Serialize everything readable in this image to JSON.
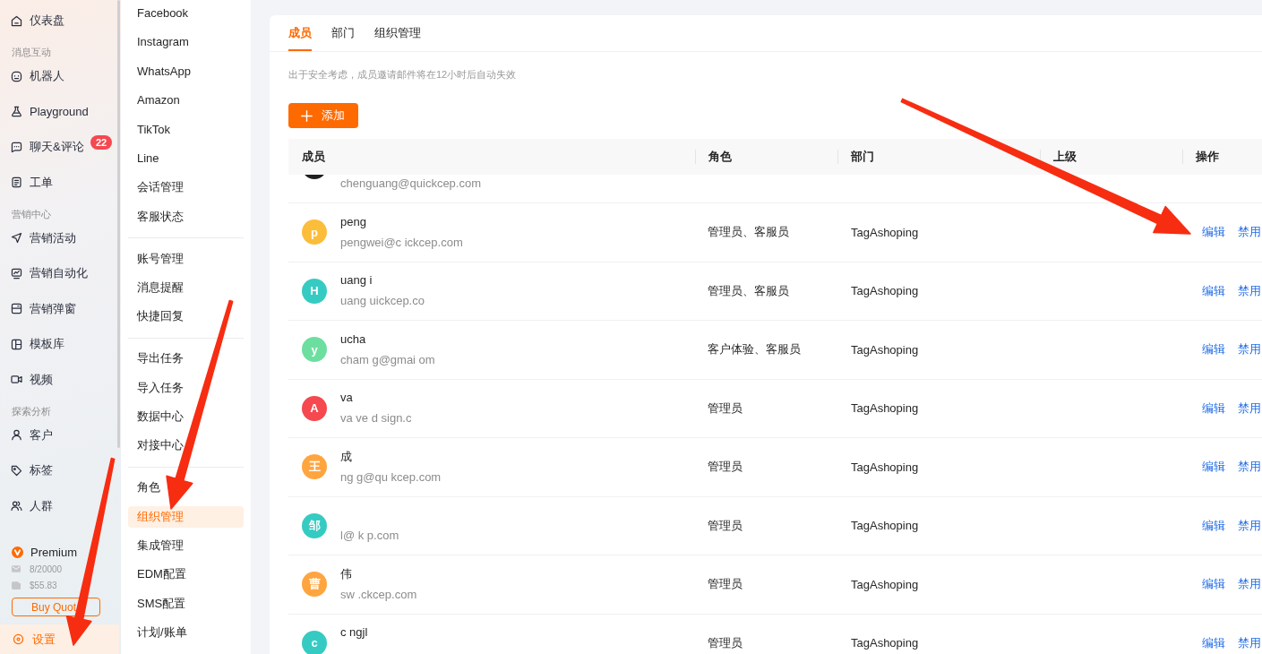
{
  "sidebar": {
    "items": [
      {
        "kind": "link",
        "label": "仪表盘",
        "selected": false
      },
      {
        "kind": "section",
        "label": "消息互动"
      },
      {
        "kind": "link",
        "label": "机器人",
        "selected": false
      },
      {
        "kind": "link",
        "label": "Playground",
        "selected": false
      },
      {
        "kind": "link",
        "label": "聊天&评论",
        "selected": false,
        "badge": "22"
      },
      {
        "kind": "link",
        "label": "工单",
        "selected": false
      },
      {
        "kind": "section",
        "label": "营销中心"
      },
      {
        "kind": "link",
        "label": "营销活动",
        "selected": false
      },
      {
        "kind": "link",
        "label": "营销自动化",
        "selected": false
      },
      {
        "kind": "link",
        "label": "营销弹窗",
        "selected": false
      },
      {
        "kind": "link",
        "label": "模板库",
        "selected": false
      },
      {
        "kind": "link",
        "label": "视频",
        "selected": false
      },
      {
        "kind": "section",
        "label": "探索分析"
      },
      {
        "kind": "link",
        "label": "客户",
        "selected": false
      },
      {
        "kind": "link",
        "label": "标签",
        "selected": false
      },
      {
        "kind": "link",
        "label": "人群",
        "selected": false
      }
    ],
    "plan": {
      "name": "Premium",
      "email_quota": "8/20000",
      "balance": "$55.83",
      "button": "Buy Quot"
    },
    "settings": {
      "label": "设置",
      "selected": true
    }
  },
  "subnav": {
    "groups": [
      {
        "items": [
          {
            "label": "Facebook",
            "selected": false
          },
          {
            "label": "Instagram",
            "selected": false
          },
          {
            "label": "WhatsApp",
            "selected": false
          },
          {
            "label": "Amazon",
            "selected": false
          },
          {
            "label": "TikTok",
            "selected": false
          },
          {
            "label": "Line",
            "selected": false
          },
          {
            "label": "会话管理",
            "selected": false
          },
          {
            "label": "客服状态",
            "selected": false
          }
        ]
      },
      {
        "items": [
          {
            "label": "账号管理",
            "selected": false
          },
          {
            "label": "消息提醒",
            "selected": false
          },
          {
            "label": "快捷回复",
            "selected": false
          }
        ]
      },
      {
        "items": [
          {
            "label": "导出任务",
            "selected": false
          },
          {
            "label": "导入任务",
            "selected": false
          },
          {
            "label": "数据中心",
            "selected": false
          },
          {
            "label": "对接中心",
            "selected": false
          }
        ]
      },
      {
        "items": [
          {
            "label": "角色",
            "selected": false
          },
          {
            "label": "组织管理",
            "selected": true
          },
          {
            "label": "集成管理",
            "selected": false
          },
          {
            "label": "EDM配置",
            "selected": false
          },
          {
            "label": "SMS配置",
            "selected": false
          },
          {
            "label": "计划/账单",
            "selected": false
          }
        ]
      }
    ]
  },
  "main": {
    "tabs": [
      {
        "label": "成员",
        "selected": true
      },
      {
        "label": "部门",
        "selected": false
      },
      {
        "label": "组织管理",
        "selected": false
      }
    ],
    "notice": "出于安全考虑，成员邀请邮件将在12小时后自动失效",
    "add_button": "添加",
    "table": {
      "columns": [
        "成员",
        "角色",
        "部门",
        "上级",
        "操作"
      ],
      "rows": [
        {
          "kind": "partial",
          "color": "#1f1f1f",
          "email": "chenguang@quickcep.com"
        },
        {
          "kind": "member",
          "initial": "p",
          "color": "#fcbd3a",
          "name": "peng",
          "email": "pengwei@c ickcep.com",
          "role": "管理员、客服员",
          "department": "TagAshoping",
          "actions": [
            "编辑",
            "禁用"
          ]
        },
        {
          "kind": "member",
          "initial": "H",
          "color": "#36cbc2",
          "name": "uang i",
          "email": "uang uickcep.co",
          "role": "管理员、客服员",
          "department": "TagAshoping",
          "actions": [
            "编辑",
            "禁用"
          ]
        },
        {
          "kind": "member",
          "initial": "y",
          "color": "#6cdfa0",
          "name": "ucha",
          "email": "cham g@gmai om",
          "role": "客户体验、客服员",
          "department": "TagAshoping",
          "actions": [
            "编辑",
            "禁用"
          ]
        },
        {
          "kind": "member",
          "initial": "A",
          "color": "#f5484f",
          "name": "va",
          "email": "va ve d sign.c",
          "role": "管理员",
          "department": "TagAshoping",
          "actions": [
            "编辑",
            "禁用"
          ]
        },
        {
          "kind": "member",
          "initial": "王",
          "color": "#ffa53f",
          "name": "成",
          "email": "ng g@qu kcep.com",
          "role": "管理员",
          "department": "TagAshoping",
          "actions": [
            "编辑",
            "禁用"
          ]
        },
        {
          "kind": "member",
          "initial": "邹",
          "color": "#36cbc2",
          "email": "l@ k p.com",
          "role": "管理员",
          "department": "TagAshoping",
          "actions": [
            "编辑",
            "禁用"
          ]
        },
        {
          "kind": "member",
          "initial": "曹",
          "color": "#ffa53f",
          "name": "伟",
          "email": "sw .ckcep.com",
          "role": "管理员",
          "department": "TagAshoping",
          "actions": [
            "编辑",
            "禁用"
          ]
        },
        {
          "kind": "member",
          "initial": "c",
          "color": "#36cbc2",
          "name": "c ngjl",
          "role": "管理员",
          "department": "TagAshoping",
          "actions": [
            "编辑",
            "禁用"
          ]
        }
      ]
    }
  },
  "annotations": [
    {
      "kind": "arrow"
    },
    {
      "kind": "arrow"
    },
    {
      "kind": "arrow"
    }
  ]
}
